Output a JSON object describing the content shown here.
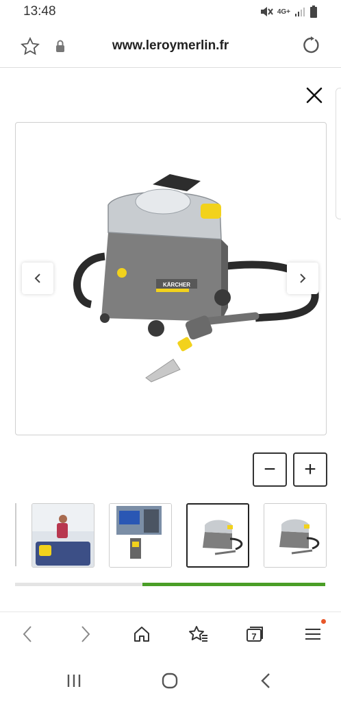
{
  "status": {
    "time": "13:48",
    "network": "4G+"
  },
  "browser": {
    "url": "www.leroymerlin.fr"
  },
  "viewer": {
    "brand_label": "KÄRCHER",
    "zoom_out_label": "−",
    "zoom_in_label": "+"
  },
  "thumbnails": [
    {
      "name": "photo-woman-cleaning-sofa",
      "selected": false
    },
    {
      "name": "photo-cleaning-car-seat",
      "selected": false
    },
    {
      "name": "product-photo-puzzi",
      "selected": true
    },
    {
      "name": "product-photo-puzzi-2",
      "selected": false
    }
  ],
  "gallery_progress": 0.59,
  "nav": {
    "tabs_count": "7"
  },
  "colors": {
    "accent": "#4a9e26",
    "notification": "#e8572a",
    "product_yellow": "#f2d21c"
  }
}
